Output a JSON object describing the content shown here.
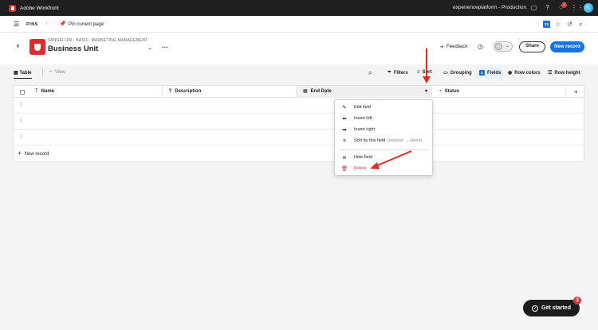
{
  "appbar": {
    "app_name": "Adobe Workfront",
    "org": "experienceplatform - Production",
    "notification_count": "2"
  },
  "pinsbar": {
    "pins_label": "PINS",
    "pin_current_page": "Pin current page",
    "calendar_badge": "23"
  },
  "header": {
    "breadcrumb": "VANGELIJW - BASIC: MARKETING MANAGEMENT",
    "title": "Business Unit",
    "feedback_label": "Feedback",
    "share_label": "Share",
    "new_record_label": "New record"
  },
  "toolbar": {
    "view_table": "Table",
    "add_view": "View",
    "filters": "Filters",
    "sort": "Sort",
    "grouping": "Grouping",
    "fields_count": "1",
    "fields": "Fields",
    "row_colors": "Row colors",
    "row_height": "Row height"
  },
  "grid": {
    "columns": [
      "Name",
      "Description",
      "End Date",
      "Status"
    ],
    "row_numbers": [
      "1",
      "2",
      "3"
    ],
    "new_record": "New record"
  },
  "menu": {
    "items": [
      {
        "label": "Edit field",
        "icon": "pencil-icon"
      },
      {
        "label": "Insert left",
        "icon": "arrow-left-icon"
      },
      {
        "label": "Insert right",
        "icon": "arrow-right-icon"
      },
      {
        "label": "Sort by this field",
        "hint": "(earliest → latest)",
        "icon": "sort-icon"
      },
      {
        "label": "Hide field",
        "icon": "eye-off-icon"
      },
      {
        "label": "Delete",
        "icon": "trash-icon"
      }
    ]
  },
  "get_started": {
    "label": "Get started",
    "badge": "3"
  },
  "colors": {
    "accent": "#1473e6",
    "danger": "#d7373f",
    "annotation": "#e8281e"
  }
}
